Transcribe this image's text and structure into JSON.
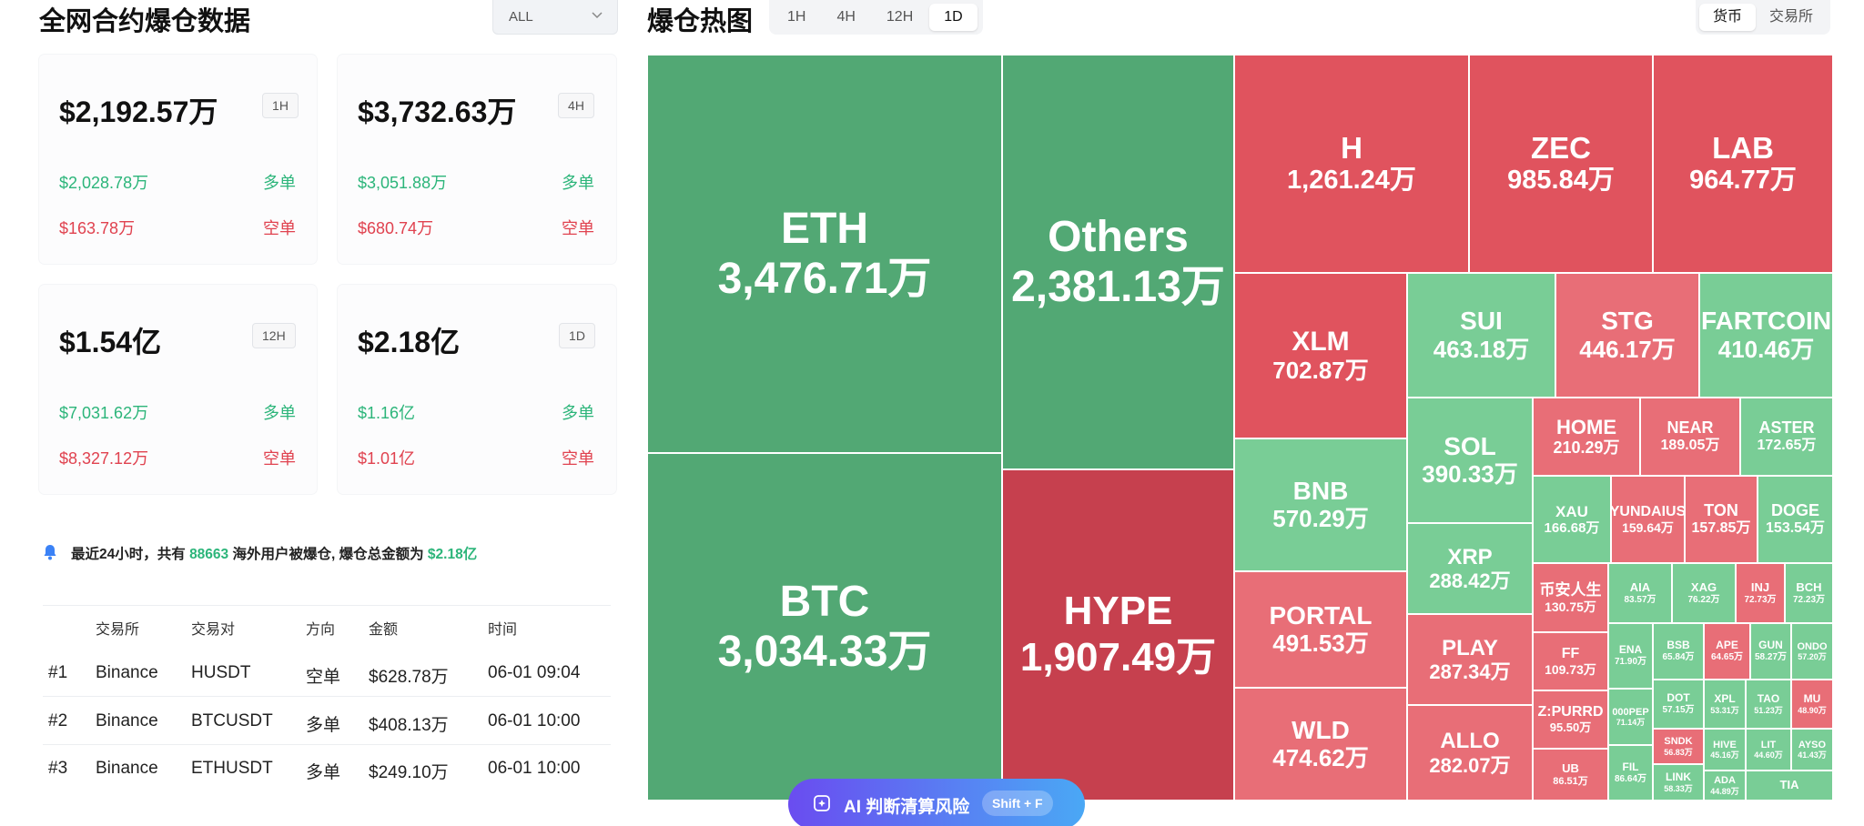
{
  "left": {
    "title": "全网合约爆仓数据",
    "filter": {
      "selected": "ALL"
    },
    "cards": [
      {
        "total": "$2,192.57万",
        "period": "1H",
        "long_value": "$2,028.78万",
        "long_label": "多单",
        "short_value": "$163.78万",
        "short_label": "空单"
      },
      {
        "total": "$3,732.63万",
        "period": "4H",
        "long_value": "$3,051.88万",
        "long_label": "多单",
        "short_value": "$680.74万",
        "short_label": "空单"
      },
      {
        "total": "$1.54亿",
        "period": "12H",
        "long_value": "$7,031.62万",
        "long_label": "多单",
        "short_value": "$8,327.12万",
        "short_label": "空单"
      },
      {
        "total": "$2.18亿",
        "period": "1D",
        "long_value": "$1.16亿",
        "long_label": "多单",
        "short_value": "$1.01亿",
        "short_label": "空单"
      }
    ],
    "notice": {
      "p1": "最近24小时，共有",
      "count": "88663",
      "p2": "海外用户被爆仓, 爆仓总金额为",
      "amount": "$2.18亿"
    },
    "table": {
      "headers": [
        "交易所",
        "交易对",
        "方向",
        "金额",
        "时间"
      ],
      "rows": [
        {
          "rank": "#1",
          "exchange": "Binance",
          "pair": "HUSDT",
          "side": "空单",
          "amount": "$628.78万",
          "time": "06-01 09:04"
        },
        {
          "rank": "#2",
          "exchange": "Binance",
          "pair": "BTCUSDT",
          "side": "多单",
          "amount": "$408.13万",
          "time": "06-01 10:00"
        },
        {
          "rank": "#3",
          "exchange": "Binance",
          "pair": "ETHUSDT",
          "side": "多单",
          "amount": "$249.10万",
          "time": "06-01 10:00"
        }
      ]
    }
  },
  "heatmap": {
    "title": "爆仓热图",
    "periods": [
      "1H",
      "4H",
      "12H",
      "1D"
    ],
    "active_period": "1D",
    "groupings": [
      "货币",
      "交易所"
    ],
    "active_grouping": "货币",
    "colors": {
      "long": "#52a874",
      "long_light": "#79cd96",
      "short": "#e0535e",
      "short_light": "#e86e77",
      "hype": "#c6404e"
    },
    "tiles": [
      {
        "sym": "ETH",
        "val": "3,476.71万",
        "c": "long"
      },
      {
        "sym": "BTC",
        "val": "3,034.33万",
        "c": "long"
      },
      {
        "sym": "Others",
        "val": "2,381.13万",
        "c": "long"
      },
      {
        "sym": "HYPE",
        "val": "1,907.49万",
        "c": "hype"
      },
      {
        "sym": "H",
        "val": "1,261.24万",
        "c": "short"
      },
      {
        "sym": "ZEC",
        "val": "985.84万",
        "c": "short"
      },
      {
        "sym": "LAB",
        "val": "964.77万",
        "c": "short"
      },
      {
        "sym": "XLM",
        "val": "702.87万",
        "c": "short"
      },
      {
        "sym": "SUI",
        "val": "463.18万",
        "c": "long_light"
      },
      {
        "sym": "STG",
        "val": "446.17万",
        "c": "short_light"
      },
      {
        "sym": "FARTCOIN",
        "val": "410.46万",
        "c": "long_light"
      },
      {
        "sym": "BNB",
        "val": "570.29万",
        "c": "long_light"
      },
      {
        "sym": "PORTAL",
        "val": "491.53万",
        "c": "short_light"
      },
      {
        "sym": "WLD",
        "val": "474.62万",
        "c": "short_light"
      },
      {
        "sym": "SOL",
        "val": "390.33万",
        "c": "long_light"
      },
      {
        "sym": "XRP",
        "val": "288.42万",
        "c": "long_light"
      },
      {
        "sym": "PLAY",
        "val": "287.34万",
        "c": "short_light"
      },
      {
        "sym": "ALLO",
        "val": "282.07万",
        "c": "short_light"
      },
      {
        "sym": "HOME",
        "val": "210.29万",
        "c": "short_light"
      },
      {
        "sym": "NEAR",
        "val": "189.05万",
        "c": "short_light"
      },
      {
        "sym": "ASTER",
        "val": "172.65万",
        "c": "long_light"
      },
      {
        "sym": "XAU",
        "val": "166.68万",
        "c": "long_light"
      },
      {
        "sym": "YUNDAIUS",
        "val": "159.64万",
        "c": "short_light"
      },
      {
        "sym": "TON",
        "val": "157.85万",
        "c": "short_light"
      },
      {
        "sym": "DOGE",
        "val": "153.54万",
        "c": "long_light"
      },
      {
        "sym": "币安人生",
        "val": "130.75万",
        "c": "short_light"
      },
      {
        "sym": "FF",
        "val": "109.73万",
        "c": "short_light"
      },
      {
        "sym": "Z:PURRD",
        "val": "95.50万",
        "c": "short_light"
      },
      {
        "sym": "UB",
        "val": "86.51万",
        "c": "short_light"
      },
      {
        "sym": "AIA",
        "val": "83.57万",
        "c": "long_light"
      },
      {
        "sym": "XAG",
        "val": "76.22万",
        "c": "long_light"
      },
      {
        "sym": "INJ",
        "val": "72.73万",
        "c": "short_light"
      },
      {
        "sym": "BCH",
        "val": "72.23万",
        "c": "long_light"
      },
      {
        "sym": "ENA",
        "val": "71.90万",
        "c": "long_light"
      },
      {
        "sym": "BSB",
        "val": "65.84万",
        "c": "long_light"
      },
      {
        "sym": "APE",
        "val": "64.65万",
        "c": "short_light"
      },
      {
        "sym": "GUN",
        "val": "58.27万",
        "c": "long_light"
      },
      {
        "sym": "ONDO",
        "val": "57.20万",
        "c": "long_light"
      },
      {
        "sym": "000PEP",
        "val": "71.14万",
        "c": "long_light"
      },
      {
        "sym": "DOT",
        "val": "57.15万",
        "c": "long_light"
      },
      {
        "sym": "XPL",
        "val": "53.31万",
        "c": "long_light"
      },
      {
        "sym": "TAO",
        "val": "51.23万",
        "c": "long_light"
      },
      {
        "sym": "MU",
        "val": "48.90万",
        "c": "short_light"
      },
      {
        "sym": "SNDK",
        "val": "56.83万",
        "c": "short_light"
      },
      {
        "sym": "HIVE",
        "val": "45.16万",
        "c": "long_light"
      },
      {
        "sym": "LIT",
        "val": "44.60万",
        "c": "long_light"
      },
      {
        "sym": "AYSO",
        "val": "41.43万",
        "c": "long_light"
      },
      {
        "sym": "FIL",
        "val": "86.64万",
        "c": "long_light"
      },
      {
        "sym": "LINK",
        "val": "58.33万",
        "c": "long_light"
      },
      {
        "sym": "ADA",
        "val": "44.89万",
        "c": "long_light"
      },
      {
        "sym": "TIA",
        "val": "",
        "c": "long_light"
      }
    ]
  },
  "ai_button": {
    "label": "AI 判断清算风险",
    "shortcut": "Shift + F"
  }
}
